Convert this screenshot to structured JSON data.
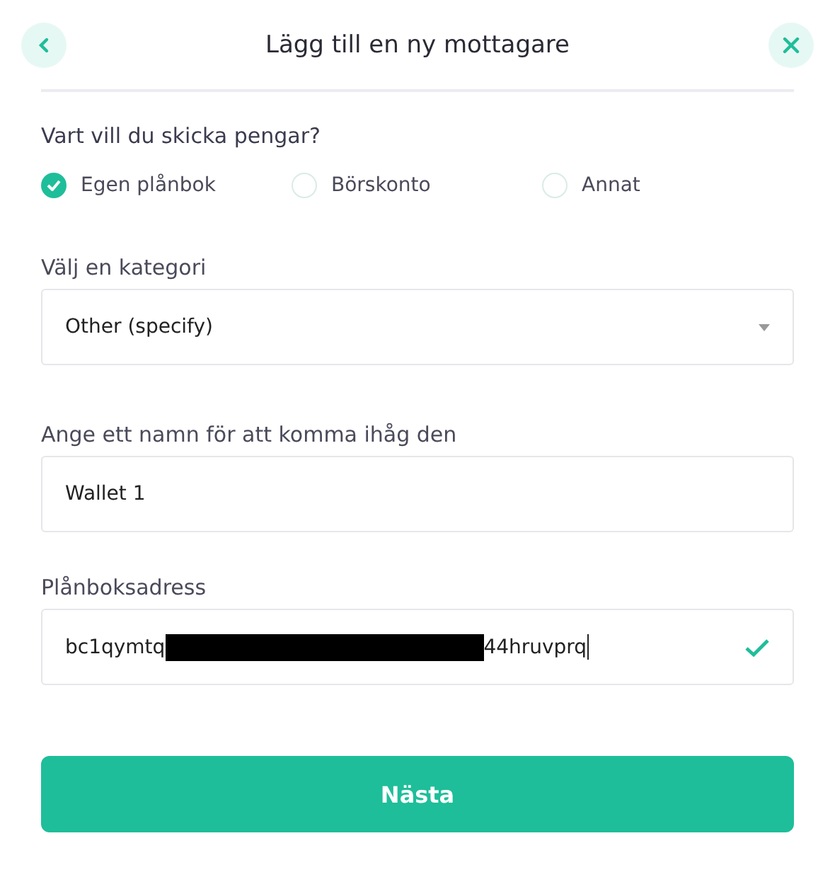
{
  "header": {
    "title": "Lägg till en ny mottagare"
  },
  "question": "Vart vill du skicka pengar?",
  "destinations": [
    {
      "label": "Egen plånbok",
      "selected": true
    },
    {
      "label": "Börskonto",
      "selected": false
    },
    {
      "label": "Annat",
      "selected": false
    }
  ],
  "category": {
    "label": "Välj en kategori",
    "value": "Other (specify)"
  },
  "name": {
    "label": "Ange ett namn för att komma ihåg den",
    "value": "Wallet 1"
  },
  "address": {
    "label": "Plånboksadress",
    "prefix": "bc1qymtq",
    "suffix": "44hruvprq",
    "redacted": true,
    "valid": true
  },
  "next_button": "Nästa"
}
